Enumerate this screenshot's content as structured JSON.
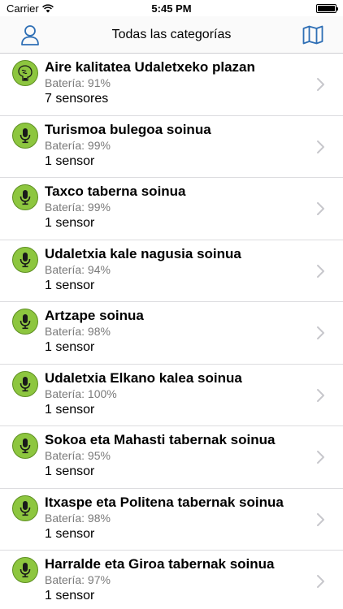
{
  "status": {
    "carrier": "Carrier",
    "time": "5:45 PM",
    "battery_level": 1.0
  },
  "nav": {
    "title": "Todas las categorías",
    "left_icon": "user-icon",
    "right_icon": "map-icon"
  },
  "items": [
    {
      "title": "Aire kalitatea Udaletxeko plazan",
      "battery": "Batería: 91%",
      "count": "7 sensores",
      "icon": "air-quality-icon"
    },
    {
      "title": "Turismoa bulegoa soinua",
      "battery": "Batería: 99%",
      "count": "1 sensor",
      "icon": "microphone-icon"
    },
    {
      "title": "Taxco taberna  soinua",
      "battery": "Batería: 99%",
      "count": "1 sensor",
      "icon": "microphone-icon"
    },
    {
      "title": "Udaletxia kale nagusia soinua",
      "battery": "Batería: 94%",
      "count": "1 sensor",
      "icon": "microphone-icon"
    },
    {
      "title": "Artzape soinua",
      "battery": "Batería: 98%",
      "count": "1 sensor",
      "icon": "microphone-icon"
    },
    {
      "title": "Udaletxia Elkano kalea soinua",
      "battery": "Batería: 100%",
      "count": "1 sensor",
      "icon": "microphone-icon"
    },
    {
      "title": " Sokoa eta Mahasti tabernak soinua",
      "battery": "Batería: 95%",
      "count": "1 sensor",
      "icon": "microphone-icon"
    },
    {
      "title": "Itxaspe eta Politena tabernak soinua",
      "battery": "Batería: 98%",
      "count": "1 sensor",
      "icon": "microphone-icon"
    },
    {
      "title": "Harralde eta Giroa tabernak soinua",
      "battery": "Batería: 97%",
      "count": "1 sensor",
      "icon": "microphone-icon"
    }
  ],
  "colors": {
    "accent": "#2f6fb5",
    "icon_green": "#8dc63f",
    "secondary_text": "#7a7a7a",
    "separator": "#dcdcdf",
    "chevron": "#c7c7cc"
  }
}
